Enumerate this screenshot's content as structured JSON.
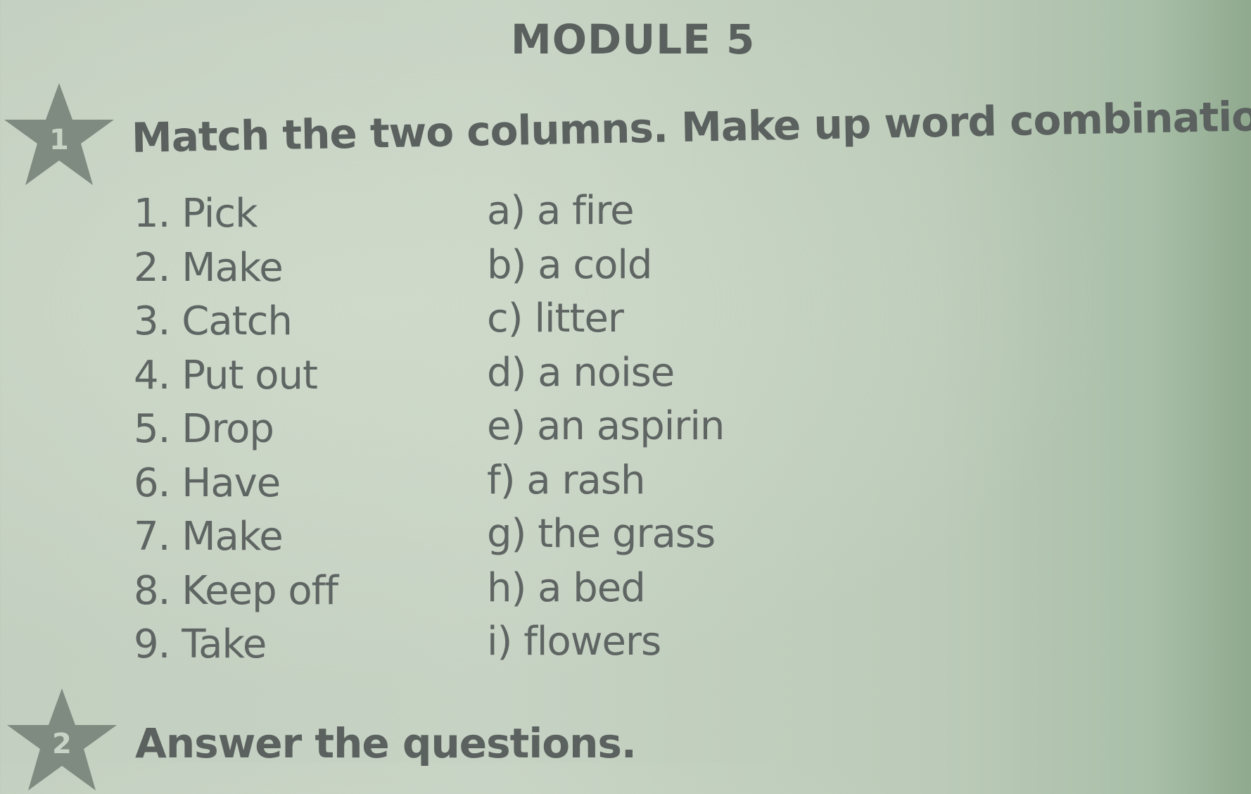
{
  "module_title": "MODULE 5",
  "tasks": [
    {
      "number": "1",
      "instruction": "Match the two columns. Make up word combinations.",
      "left_column": [
        "1. Pick",
        "2. Make",
        "3. Catch",
        "4. Put out",
        "5. Drop",
        "6. Have",
        "7. Make",
        "8. Keep off",
        "9. Take"
      ],
      "right_column": [
        "a) a fire",
        "b) a cold",
        "c) litter",
        "d) a noise",
        "e) an aspirin",
        "f) a rash",
        "g) the grass",
        "h) a bed",
        "i) flowers"
      ]
    },
    {
      "number": "2",
      "instruction": "Answer the questions."
    }
  ],
  "colors": {
    "paper": "#c3cfc0",
    "ink": "#5f6563",
    "star": "#7f8a80"
  }
}
